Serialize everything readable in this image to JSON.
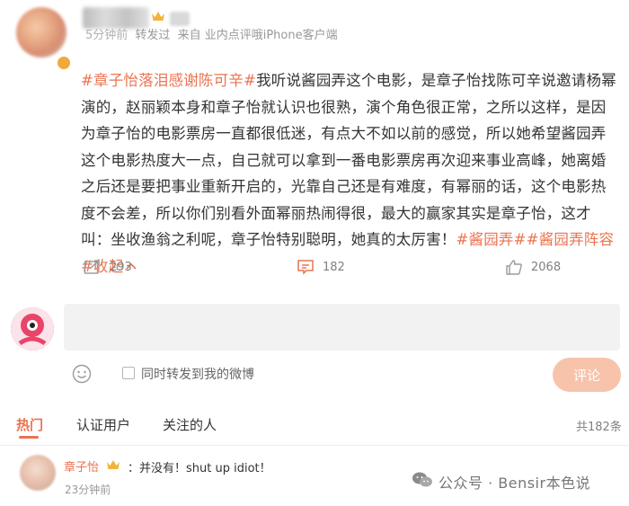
{
  "post": {
    "meta_time": "5分钟前",
    "meta_repost": "转发过",
    "meta_source": "来自 业内点评哦iPhone客户端",
    "segments": [
      {
        "type": "tag",
        "text": "#章子怡落泪感谢陈可辛#"
      },
      {
        "type": "text",
        "text": "我听说酱园弄这个电影，是章子怡找陈可辛说邀请杨幂演的，赵丽颖本身和章子怡就认识也很熟，演个角色很正常，之所以这样，是因为章子怡的电影票房一直都很低迷，有点大不如以前的感觉，所以她希望酱园弄这个电影热度大一点，自己就可以拿到一番电影票房再次迎来事业高峰，她离婚之后还是要把事业重新开启的，光靠自己还是有难度，有幂丽的话，这个电影热度不会差，所以你们别看外面幂丽热闹得很，最大的赢家其实是章子怡，这才叫：坐收渔翁之利呢，章子怡特别聪明，她真的太厉害！"
      },
      {
        "type": "tag",
        "text": "#酱园弄#"
      },
      {
        "type": "tag",
        "text": "#酱园弄阵容#"
      }
    ],
    "collapse_label": "收起"
  },
  "actions": {
    "repost_count": "293",
    "comment_count": "182",
    "like_count": "2068"
  },
  "composer": {
    "repost_label": "同时转发到我的微博",
    "submit_label": "评论"
  },
  "tabs": {
    "hot": "热门",
    "verified": "认证用户",
    "following": "关注的人"
  },
  "total_comments": "共182条",
  "comment": {
    "username": "章子怡",
    "text": "：并没有！shut up idiot！",
    "time": "23分钟前"
  },
  "watermark": "公众号 · Bensir本色说",
  "colors": {
    "accent": "#eb7350",
    "submit_disabled": "#f7c3ab"
  }
}
